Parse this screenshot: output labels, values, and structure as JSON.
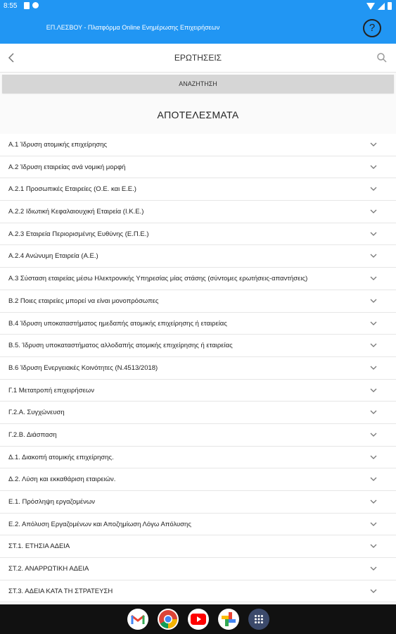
{
  "status_bar": {
    "time": "8:55"
  },
  "app_bar": {
    "title": "ΕΠ.ΛΕΣΒΟΥ - Πλατφόρμα Online Ενημέρωσης Επιχειρήσεων",
    "help_label": "?"
  },
  "nav": {
    "title": "ΕΡΩΤΗΣΕΙΣ"
  },
  "search_button_label": "ΑΝΑΖΗΤΗΣΗ",
  "results_heading": "ΑΠΟΤΕΛΕΣΜΑΤΑ",
  "questions": [
    "Α.1 Ίδρυση ατομικής επιχείρησης",
    "Α.2 Ίδρυση εταιρείας ανά νομική μορφή",
    "Α.2.1  Προσωπικές Εταιρείες (Ο.Ε. και Ε.Ε.)",
    "Α.2.2  Ιδιωτική Κεφαλαιουχική Εταιρεία (Ι.Κ.Ε.)",
    "Α.2.3  Εταιρεία Περιορισμένης Ευθύνης (Ε.Π.Ε.)",
    "Α.2.4  Ανώνυμη Εταιρεία (Α.Ε.)",
    "Α.3  Σύσταση εταιρείας μέσω Ηλεκτρονικής Υπηρεσίας μίας στάσης (σύντομες ερωτήσεις-απαντήσεις)",
    "Β.2  Ποιες εταιρείες μπορεί να είναι μονοπρόσωπες",
    "Β.4  Ίδρυση υποκαταστήματος ημεδαπής ατομικής επιχείρησης ή εταιρείας",
    "Β.5.  Ίδρυση υποκαταστήματος αλλοδαπής ατομικής επιχείρησης ή εταιρείας",
    "Β.6  Ίδρυση Ενεργειακές Κοινότητες (Ν.4513/2018)",
    "Γ.1  Μετατροπή επιχειρήσεων",
    "Γ.2.Α.  Συγχώνευση",
    "Γ.2.Β.  Διάσπαση",
    "Δ.1.  Διακοπή ατομικής επιχείρησης.",
    "Δ.2.  Λύση και εκκαθάριση εταιρειών.",
    "Ε.1.  Πρόσληψη εργαζομένων",
    "Ε.2.  Απόλυση Εργαζομένων και Αποζημίωση Λόγω Απόλυσης",
    "ΣΤ.1.  ΕΤΗΣΙΑ ΑΔΕΙΑ",
    "ΣΤ.2.  ΑΝΑΡΡΩΤΙΚΗ ΑΔΕΙΑ",
    "ΣΤ.3.  ΑΔΕΙΑ ΚΑΤΑ ΤΗ ΣΤΡΑΤΕΥΣΗ"
  ],
  "colors": {
    "accent": "#2196f3",
    "search_bg": "#d6d6d6",
    "nav_bar": "#111111"
  },
  "dock_apps": [
    "gmail-icon",
    "chrome-icon",
    "youtube-icon",
    "photos-icon",
    "app-drawer-icon"
  ]
}
